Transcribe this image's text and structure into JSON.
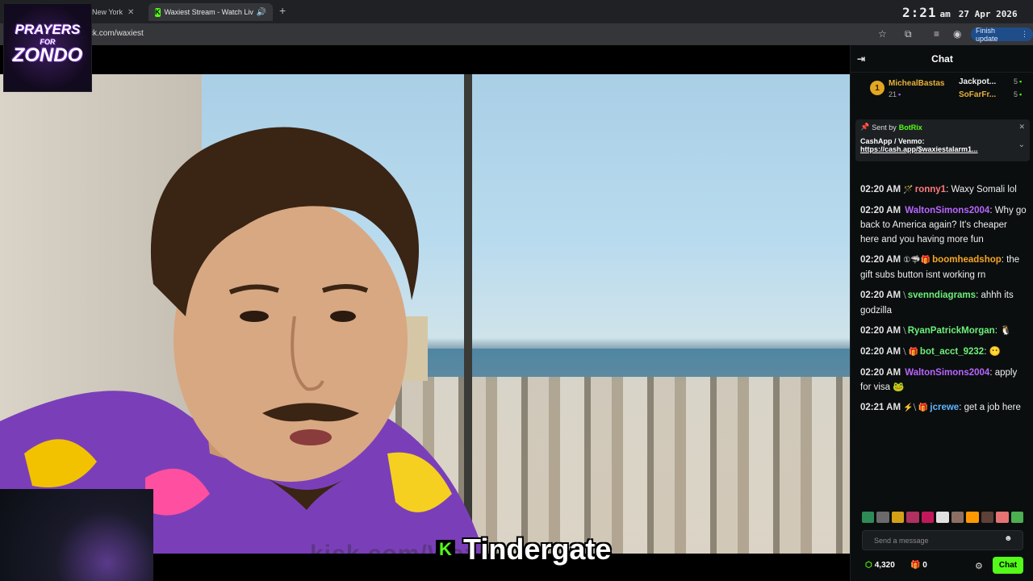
{
  "browser": {
    "tabs": [
      {
        "label": "New York",
        "close": "✕"
      },
      {
        "label": "Waxiest Stream - Watch Liv",
        "close": "✕"
      }
    ],
    "new_tab": "+",
    "url": "ck.com/waxiest",
    "finish_update": "Finish update"
  },
  "clock": {
    "time": "2:21",
    "ampm": "am",
    "date": "27 Apr 2026"
  },
  "overlay": {
    "logo_line1": "PRAYERS",
    "logo_line2": "FOR",
    "logo_line3": "ZONDO",
    "watermark": "kick.com/Waxiest",
    "caption": "Tindergate"
  },
  "chat": {
    "title": "Chat",
    "leaderboard": [
      {
        "rank": "1",
        "name": "MichealBastas",
        "count": "21"
      },
      {
        "name": "Jackpot...",
        "count": "5"
      },
      {
        "name": "SoFarFr...",
        "count": "5"
      }
    ],
    "pinned": {
      "sent_by": "Sent by",
      "bot": "BotRix",
      "line1": "CashApp / Venmo:",
      "line2": "https://cash.app/$waxiestalarm1..."
    },
    "messages": [
      {
        "time": "02:20 AM",
        "badges": "🪄",
        "user": "ronny1",
        "color": "#ff7b7b",
        "text": "Waxy Somali lol"
      },
      {
        "time": "02:20 AM",
        "badges": "",
        "user": "WaltonSimons2004",
        "color": "#b865ff",
        "text": "Why go back to America again? It's cheaper here and you having more fun"
      },
      {
        "time": "02:20 AM",
        "badges": "①🦈🎁",
        "user": "boomheadshop",
        "color": "#f5a623",
        "text": "the gift subs button isnt working rn"
      },
      {
        "time": "02:20 AM",
        "badges": "⧹",
        "user": "svenndiagrams",
        "color": "#6cf07a",
        "text": "ahhh its godzilla"
      },
      {
        "time": "02:20 AM",
        "badges": "⧹",
        "user": "RyanPatrickMorgan",
        "color": "#6cf07a",
        "text": "🐧"
      },
      {
        "time": "02:20 AM",
        "badges": "⧹ 🎁",
        "user": "bot_acct_9232",
        "color": "#6cf07a",
        "text": "😶"
      },
      {
        "time": "02:20 AM",
        "badges": "",
        "user": "WaltonSimons2004",
        "color": "#b865ff",
        "text": "apply for visa 🐸"
      },
      {
        "time": "02:21 AM",
        "badges": "⚡⧹ 🎁",
        "user": "jcrewe",
        "color": "#5fb6ff",
        "text": "get a job here"
      }
    ],
    "emotes": [
      "#2e8b57",
      "#6a6a6a",
      "#d4a017",
      "#b03060",
      "#c2185b",
      "#e0e0e0",
      "#8d6e63",
      "#ff9800",
      "#5d4037",
      "#e57373",
      "#4caf50"
    ],
    "send_placeholder": "Send a message",
    "points": "4,320",
    "gifts": "0",
    "chat_button": "Chat"
  }
}
